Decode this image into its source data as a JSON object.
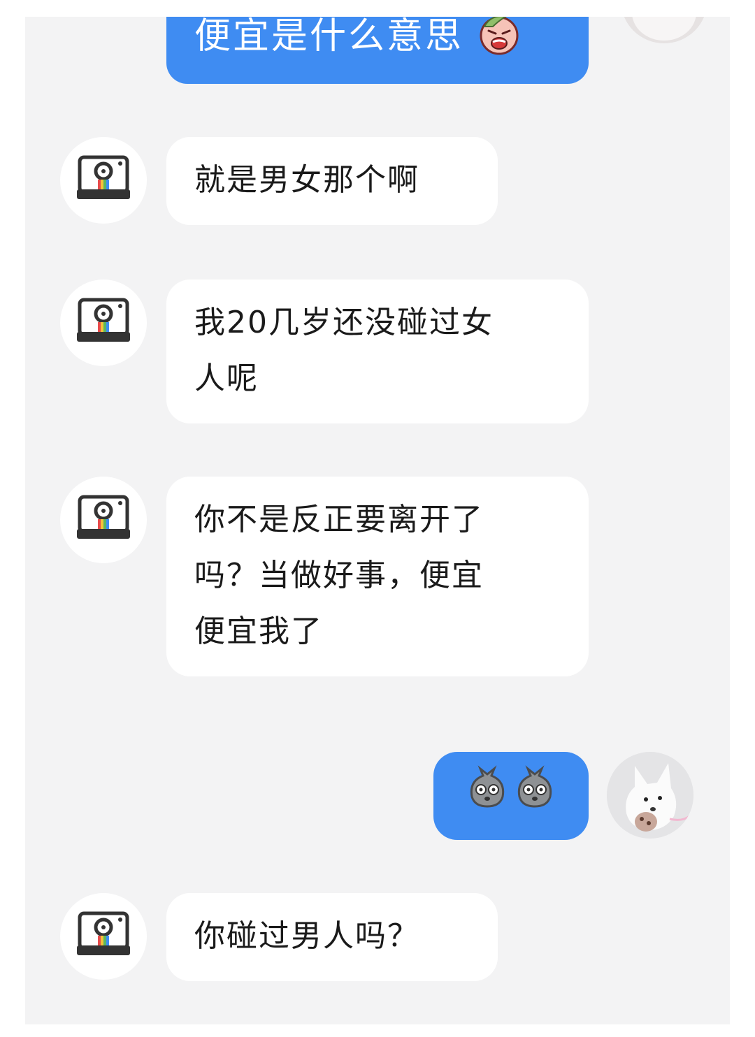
{
  "conversation": {
    "messages": [
      {
        "id": "m1",
        "side": "right",
        "text": "便宜是什么意思",
        "emoji": "crying-face-emoji"
      },
      {
        "id": "m2",
        "side": "left",
        "text": "就是男女那个啊"
      },
      {
        "id": "m3",
        "side": "left",
        "lines": [
          "我20几岁还没碰过女",
          "人呢"
        ]
      },
      {
        "id": "m4",
        "side": "left",
        "lines": [
          "你不是反正要离开了",
          "吗？当做好事，便宜",
          "便宜我了"
        ]
      },
      {
        "id": "m5",
        "side": "right",
        "stickers": [
          "sack-face-sticker",
          "sack-face-sticker"
        ]
      },
      {
        "id": "m6",
        "side": "left",
        "text": "你碰过男人吗？"
      }
    ]
  },
  "avatars": {
    "left_icon": "camera-icon",
    "right_icon": "white-dog-photo"
  },
  "colors": {
    "chat_background": "#f3f3f4",
    "outgoing_bubble": "#3f8cf2",
    "incoming_bubble": "#ffffff",
    "text_dark": "#1a1a1a"
  }
}
